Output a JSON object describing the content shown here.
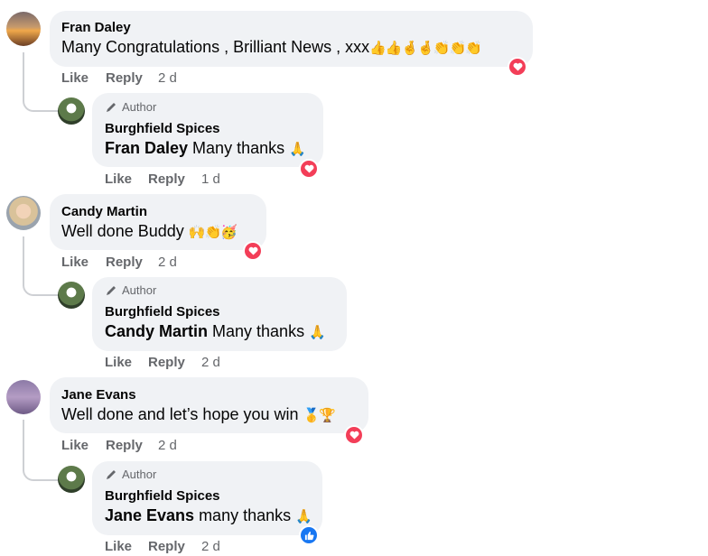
{
  "actions": {
    "like": "Like",
    "reply": "Reply"
  },
  "comments": [
    {
      "name": "Fran Daley",
      "text": "Many Congratulations , Brilliant News , xxx",
      "emojis": "👍👍🤞🤞👏👏👏",
      "time": "2 d",
      "reaction": "heart",
      "reply": {
        "badge": "Author",
        "name": "Burghfield Spices",
        "mention": "Fran Daley",
        "text": " Many thanks ",
        "emojis": "🙏",
        "time": "1 d",
        "reaction": "heart"
      }
    },
    {
      "name": "Candy Martin",
      "text": "Well done Buddy ",
      "emojis": "🙌👏🥳",
      "time": "2 d",
      "reaction": "heart",
      "reply": {
        "badge": "Author",
        "name": "Burghfield Spices",
        "mention": "Candy Martin",
        "text": " Many thanks ",
        "emojis": "🙏",
        "time": "2 d",
        "reaction": "none"
      }
    },
    {
      "name": "Jane Evans",
      "text": "Well done and let’s hope you win ",
      "emojis": "🥇🏆",
      "time": "2 d",
      "reaction": "heart",
      "reply": {
        "badge": "Author",
        "name": "Burghfield Spices",
        "mention": "Jane Evans",
        "text": " many thanks ",
        "emojis": "🙏",
        "time": "2 d",
        "reaction": "like"
      }
    }
  ],
  "colors": {
    "bubble": "#f0f2f5",
    "meta": "#65676b",
    "heart": "#f33e58",
    "like": "#1877f2"
  }
}
